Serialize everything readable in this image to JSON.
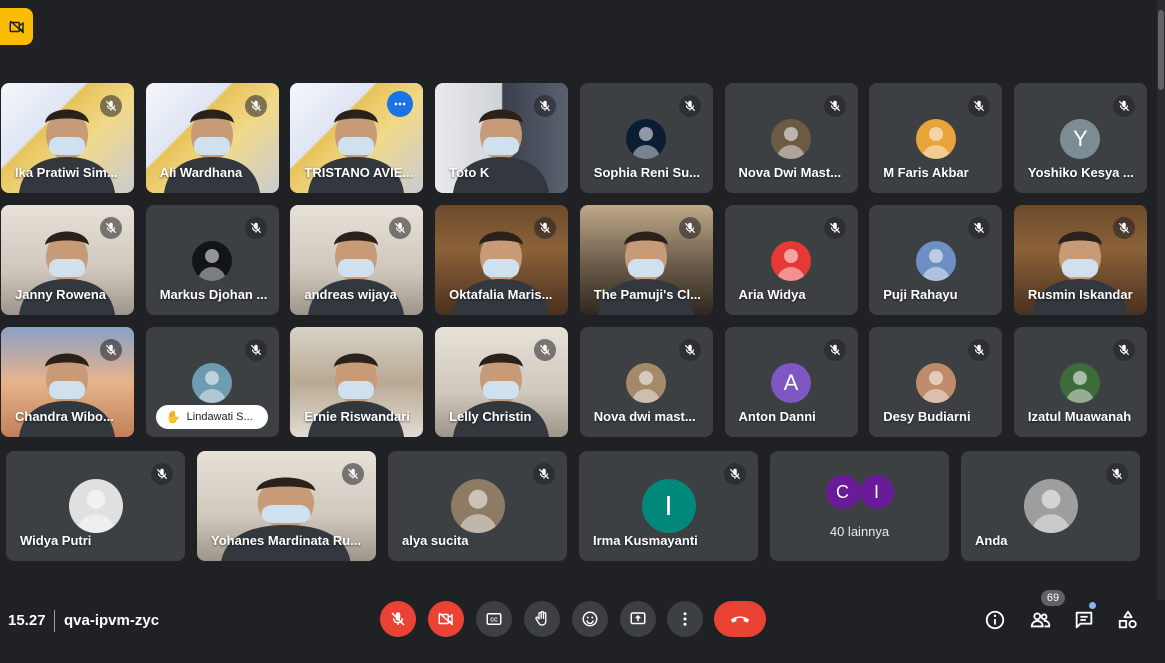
{
  "colors": {
    "background": "#202124",
    "tile": "#3c4043",
    "accent_red": "#ea4335",
    "accent_blue": "#8ab4f8",
    "badge_yellow": "#fbbc04"
  },
  "meeting": {
    "time": "15.27",
    "code": "qva-ipvm-zyc",
    "participant_count": "69"
  },
  "participants": [
    {
      "name": "Ika Pratiwi Sim...",
      "muted": true,
      "kind": "video",
      "scene": "poster"
    },
    {
      "name": "Ali Wardhana",
      "muted": true,
      "kind": "video",
      "scene": "poster"
    },
    {
      "name": "TRISTANO AVIE...",
      "muted": false,
      "kind": "video",
      "scene": "poster",
      "selected": true,
      "more": true
    },
    {
      "name": "Toto K",
      "muted": true,
      "kind": "video",
      "scene": "office"
    },
    {
      "name": "Sophia Reni Su...",
      "muted": true,
      "kind": "avatar",
      "avatar_icon": "hijab-person-icon",
      "avatar_color": "#0b1d33"
    },
    {
      "name": "Nova Dwi Mast...",
      "muted": true,
      "kind": "avatar",
      "avatar_icon": "person-photo-icon",
      "avatar_color": "#6d5a45"
    },
    {
      "name": "M Faris Akbar",
      "muted": true,
      "kind": "avatar",
      "avatar_icon": "cartoon-face-icon",
      "avatar_color": "#e8a33a"
    },
    {
      "name": "Yoshiko Kesya ...",
      "muted": true,
      "kind": "avatar",
      "avatar_letter": "Y",
      "avatar_color": "#7b8d93"
    },
    {
      "name": "Janny Rowena",
      "muted": true,
      "kind": "video",
      "scene": "room-light"
    },
    {
      "name": "Markus Djohan ...",
      "muted": true,
      "kind": "avatar",
      "avatar_icon": "figure-icon",
      "avatar_color": "#111418"
    },
    {
      "name": "andreas wijaya",
      "muted": true,
      "kind": "video",
      "scene": "room-light"
    },
    {
      "name": "Oktafalia Maris...",
      "muted": true,
      "kind": "video",
      "scene": "room-warm"
    },
    {
      "name": "The Pamuji's Cl...",
      "muted": true,
      "kind": "video",
      "scene": "room-dark"
    },
    {
      "name": "Aria Widya",
      "muted": true,
      "kind": "avatar",
      "avatar_icon": "snack-logo-icon",
      "avatar_color": "#e53935"
    },
    {
      "name": "Puji Rahayu",
      "muted": true,
      "kind": "avatar",
      "avatar_icon": "sky-photo-icon",
      "avatar_color": "#6d8fc4"
    },
    {
      "name": "Rusmin Iskandar",
      "muted": true,
      "kind": "video",
      "scene": "room-warm"
    },
    {
      "name": "Chandra Wibo...",
      "muted": true,
      "kind": "video",
      "scene": "room-sunset"
    },
    {
      "name": "Lindawati S...",
      "muted": true,
      "kind": "avatar-hand",
      "avatar_icon": "landscape-photo-icon",
      "avatar_color": "#6e9bb0"
    },
    {
      "name": "Ernie Riswandari",
      "muted": false,
      "kind": "video",
      "scene": "shelf"
    },
    {
      "name": "Lelly Christin",
      "muted": true,
      "kind": "video",
      "scene": "room-light"
    },
    {
      "name": "Nova dwi mast...",
      "muted": true,
      "kind": "avatar",
      "avatar_icon": "hijab-photo-icon",
      "avatar_color": "#a58a6a"
    },
    {
      "name": "Anton Danni",
      "muted": true,
      "kind": "avatar",
      "avatar_letter": "A",
      "avatar_color": "#7e57c2"
    },
    {
      "name": "Desy Budiarni",
      "muted": true,
      "kind": "avatar",
      "avatar_icon": "bear-cartoon-icon",
      "avatar_color": "#c08b6a"
    },
    {
      "name": "Izatul Muawanah",
      "muted": true,
      "kind": "avatar",
      "avatar_icon": "garden-photo-icon",
      "avatar_color": "#3e6b3a"
    },
    {
      "name": "Widya Putri",
      "muted": true,
      "kind": "avatar-lg",
      "avatar_icon": "sketch-photo-icon",
      "avatar_color": "#e0e0e0"
    },
    {
      "name": "Yohanes Mardinata Ru...",
      "muted": true,
      "kind": "video",
      "scene": "room-light"
    },
    {
      "name": "alya sucita",
      "muted": true,
      "kind": "avatar-lg",
      "avatar_icon": "cat-photo-icon",
      "avatar_color": "#8d7b63"
    },
    {
      "name": "Irma Kusmayanti",
      "muted": true,
      "kind": "avatar-lg",
      "avatar_letter": "I",
      "avatar_color": "#00897b"
    },
    {
      "name": "",
      "muted": false,
      "kind": "more",
      "more_letters": [
        "C",
        "I"
      ],
      "more_label": "40 lainnya",
      "avatar_color": "#6a1b9a"
    },
    {
      "name": "Anda",
      "muted": true,
      "kind": "avatar-lg",
      "avatar_icon": "arch-photo-icon",
      "avatar_color": "#9e9e9e"
    }
  ],
  "controls": [
    {
      "name": "microphone-off-button",
      "icon": "mic-off-icon",
      "variant": "red"
    },
    {
      "name": "camera-off-button",
      "icon": "camera-off-icon",
      "variant": "red"
    },
    {
      "name": "captions-button",
      "icon": "captions-icon",
      "variant": "dark"
    },
    {
      "name": "raise-hand-button",
      "icon": "hand-icon",
      "variant": "dark"
    },
    {
      "name": "reactions-button",
      "icon": "emoji-icon",
      "variant": "dark"
    },
    {
      "name": "present-screen-button",
      "icon": "present-icon",
      "variant": "dark"
    },
    {
      "name": "more-options-button",
      "icon": "more-vert-icon",
      "variant": "dark"
    },
    {
      "name": "leave-call-button",
      "icon": "hangup-icon",
      "variant": "red"
    }
  ],
  "side_controls": [
    {
      "name": "meeting-info-button",
      "icon": "info-icon"
    },
    {
      "name": "people-button",
      "icon": "people-icon"
    },
    {
      "name": "chat-button",
      "icon": "chat-icon"
    },
    {
      "name": "activities-button",
      "icon": "activities-icon"
    }
  ]
}
